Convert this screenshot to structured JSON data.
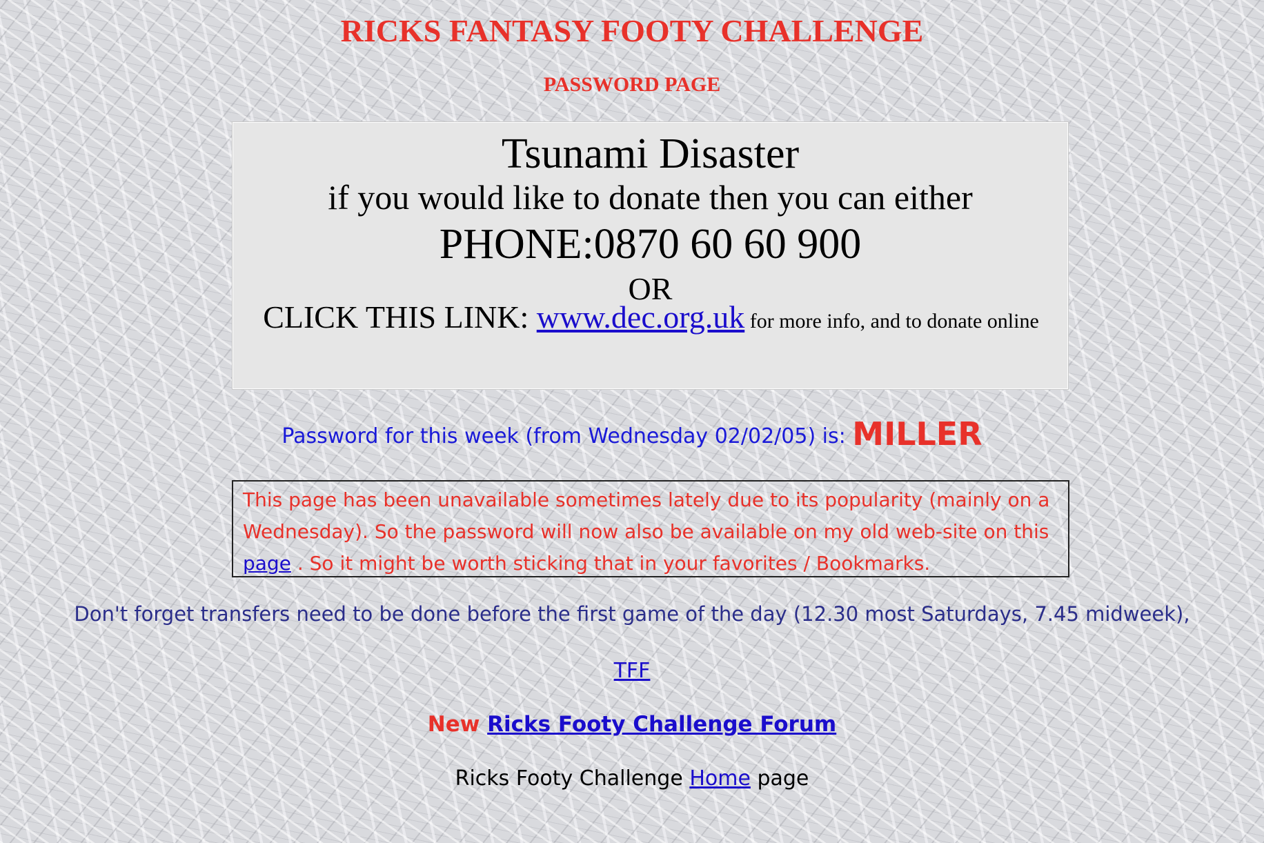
{
  "header": {
    "title": "RICKS FANTASY FOOTY CHALLENGE",
    "subtitle": "PASSWORD PAGE"
  },
  "tsunami": {
    "heading": "Tsunami Disaster",
    "line2": "if you would like to donate then you can either",
    "phone": "PHONE:0870 60 60 900",
    "or": "OR",
    "click_prefix": "CLICK THIS LINK: ",
    "link_text": "www.dec.org.uk",
    "link_suffix": " for more info, and to donate online"
  },
  "password": {
    "prefix": "Password for this week (from Wednesday 02/02/05) is: ",
    "value": "MILLER"
  },
  "notice": {
    "text_before": "This page has been unavailable sometimes lately due to its popularity (mainly on a Wednesday). So the password will now also be available on my old web-site on this ",
    "link_text": "page",
    "text_after": " . So it might be worth sticking that in your favorites / Bookmarks."
  },
  "transfers": {
    "text": "Don't forget transfers need to be done before the first game of the day (12.30 most Saturdays, 7.45 midweek),"
  },
  "links": {
    "tff": "TFF",
    "forum_new": "New",
    "forum_link": "Ricks Footy Challenge Forum",
    "home_prefix": "Ricks Footy Challenge ",
    "home_link": "Home",
    "home_suffix": " page"
  },
  "colors": {
    "title_red": "#e8312a",
    "link_blue": "#1a0dcc",
    "password_blue": "#1a1ad8",
    "transfers_navy": "#2b2e8a",
    "box_grey": "#e6e6e6"
  }
}
